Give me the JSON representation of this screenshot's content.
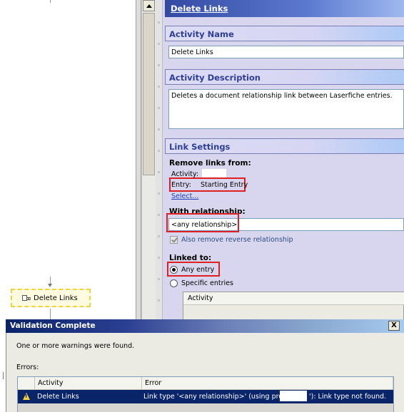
{
  "designer": {
    "activity_node_label": "Delete Links"
  },
  "properties": {
    "title": "Delete Links",
    "activity_name": {
      "header": "Activity Name",
      "value": "Delete Links"
    },
    "activity_description": {
      "header": "Activity Description",
      "value": "Deletes a document relationship link between Laserfiche entries."
    },
    "link_settings": {
      "header": "Link Settings",
      "remove_links_from": "Remove links from:",
      "activity_label": "Activity:",
      "entry_label": "Entry:",
      "entry_value": "Starting Entry",
      "select_link": "Select...",
      "with_relationship": "With relationship:",
      "relationship_value": "<any relationship>",
      "also_remove_reverse": "Also remove reverse relationship",
      "linked_to": "Linked to:",
      "any_entry": "Any entry",
      "specific_entries": "Specific entries",
      "table_column_activity": "Activity"
    }
  },
  "dialog": {
    "title": "Validation Complete",
    "message": "One or more warnings were found.",
    "errors_label": "Errors:",
    "columns": [
      "Activity",
      "Error"
    ],
    "rows": [
      {
        "activity": "Delete Links",
        "error_prefix": "Link type '<any relationship>' (using profile ",
        "error_suffix": "'): Link type not found."
      }
    ],
    "close_label": "X"
  }
}
